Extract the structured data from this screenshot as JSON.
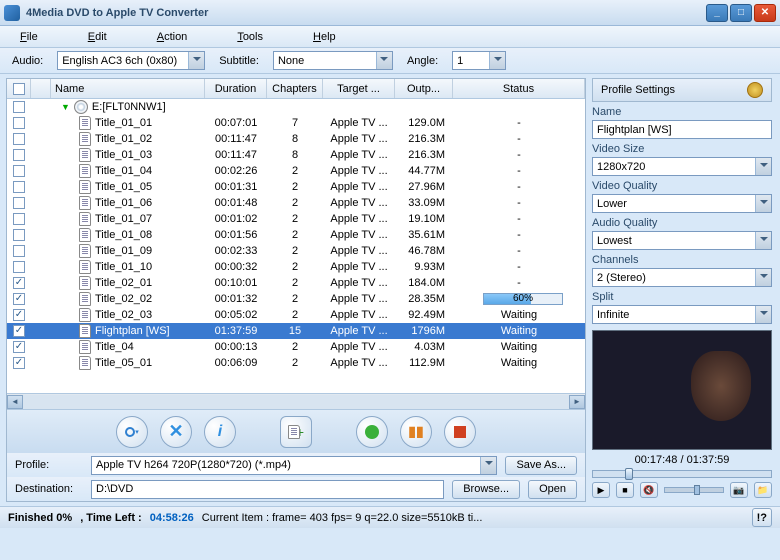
{
  "window": {
    "title": "4Media DVD to Apple TV Converter"
  },
  "menu": {
    "file": "File",
    "edit": "Edit",
    "action": "Action",
    "tools": "Tools",
    "help": "Help"
  },
  "opts": {
    "audio_label": "Audio:",
    "audio_value": "English AC3 6ch (0x80)",
    "subtitle_label": "Subtitle:",
    "subtitle_value": "None",
    "angle_label": "Angle:",
    "angle_value": "1"
  },
  "columns": {
    "name": "Name",
    "duration": "Duration",
    "chapters": "Chapters",
    "target": "Target ...",
    "output": "Outp...",
    "status": "Status"
  },
  "disc_label": "E:[FLT0NNW1]",
  "rows": [
    {
      "chk": false,
      "name": "Title_01_01",
      "dur": "00:07:01",
      "ch": "7",
      "tgt": "Apple TV ...",
      "out": "129.0M",
      "stat": "-"
    },
    {
      "chk": false,
      "name": "Title_01_02",
      "dur": "00:11:47",
      "ch": "8",
      "tgt": "Apple TV ...",
      "out": "216.3M",
      "stat": "-"
    },
    {
      "chk": false,
      "name": "Title_01_03",
      "dur": "00:11:47",
      "ch": "8",
      "tgt": "Apple TV ...",
      "out": "216.3M",
      "stat": "-"
    },
    {
      "chk": false,
      "name": "Title_01_04",
      "dur": "00:02:26",
      "ch": "2",
      "tgt": "Apple TV ...",
      "out": "44.77M",
      "stat": "-"
    },
    {
      "chk": false,
      "name": "Title_01_05",
      "dur": "00:01:31",
      "ch": "2",
      "tgt": "Apple TV ...",
      "out": "27.96M",
      "stat": "-"
    },
    {
      "chk": false,
      "name": "Title_01_06",
      "dur": "00:01:48",
      "ch": "2",
      "tgt": "Apple TV ...",
      "out": "33.09M",
      "stat": "-"
    },
    {
      "chk": false,
      "name": "Title_01_07",
      "dur": "00:01:02",
      "ch": "2",
      "tgt": "Apple TV ...",
      "out": "19.10M",
      "stat": "-"
    },
    {
      "chk": false,
      "name": "Title_01_08",
      "dur": "00:01:56",
      "ch": "2",
      "tgt": "Apple TV ...",
      "out": "35.61M",
      "stat": "-"
    },
    {
      "chk": false,
      "name": "Title_01_09",
      "dur": "00:02:33",
      "ch": "2",
      "tgt": "Apple TV ...",
      "out": "46.78M",
      "stat": "-"
    },
    {
      "chk": false,
      "name": "Title_01_10",
      "dur": "00:00:32",
      "ch": "2",
      "tgt": "Apple TV ...",
      "out": "9.93M",
      "stat": "-"
    },
    {
      "chk": true,
      "name": "Title_02_01",
      "dur": "00:10:01",
      "ch": "2",
      "tgt": "Apple TV ...",
      "out": "184.0M",
      "stat": "-"
    },
    {
      "chk": true,
      "name": "Title_02_02",
      "dur": "00:01:32",
      "ch": "2",
      "tgt": "Apple TV ...",
      "out": "28.35M",
      "stat": "progress",
      "pct": 60
    },
    {
      "chk": true,
      "name": "Title_02_03",
      "dur": "00:05:02",
      "ch": "2",
      "tgt": "Apple TV ...",
      "out": "92.49M",
      "stat": "Waiting"
    },
    {
      "chk": true,
      "sel": true,
      "name": "Flightplan [WS]",
      "dur": "01:37:59",
      "ch": "15",
      "tgt": "Apple TV ...",
      "out": "1796M",
      "stat": "Waiting"
    },
    {
      "chk": true,
      "name": "Title_04",
      "dur": "00:00:13",
      "ch": "2",
      "tgt": "Apple TV ...",
      "out": "4.03M",
      "stat": "Waiting"
    },
    {
      "chk": true,
      "name": "Title_05_01",
      "dur": "00:06:09",
      "ch": "2",
      "tgt": "Apple TV ...",
      "out": "112.9M",
      "stat": "Waiting"
    }
  ],
  "cfg": {
    "profile_label": "Profile:",
    "profile_value": "Apple TV h264 720P(1280*720)  (*.mp4)",
    "saveas": "Save As...",
    "dest_label": "Destination:",
    "dest_value": "D:\\DVD",
    "browse": "Browse...",
    "open": "Open"
  },
  "status": {
    "finished": "Finished 0%",
    "timeleft_label": ", Time Left :",
    "timeleft": "04:58:26",
    "current": "Current Item : frame=  403 fps=  9 q=22.0 size=5510kB ti...",
    "alert": "!?"
  },
  "panel": {
    "title": "Profile Settings",
    "props": [
      {
        "label": "Name",
        "value": "Flightplan [WS]",
        "type": "text"
      },
      {
        "label": "Video Size",
        "value": "1280x720",
        "type": "combo"
      },
      {
        "label": "Video Quality",
        "value": "Lower",
        "type": "combo"
      },
      {
        "label": "Audio Quality",
        "value": "Lowest",
        "type": "combo"
      },
      {
        "label": "Channels",
        "value": "2 (Stereo)",
        "type": "combo"
      },
      {
        "label": "Split",
        "value": "Infinite",
        "type": "combo"
      }
    ]
  },
  "preview": {
    "time": "00:17:48 / 01:37:59",
    "pos_pct": 18
  }
}
